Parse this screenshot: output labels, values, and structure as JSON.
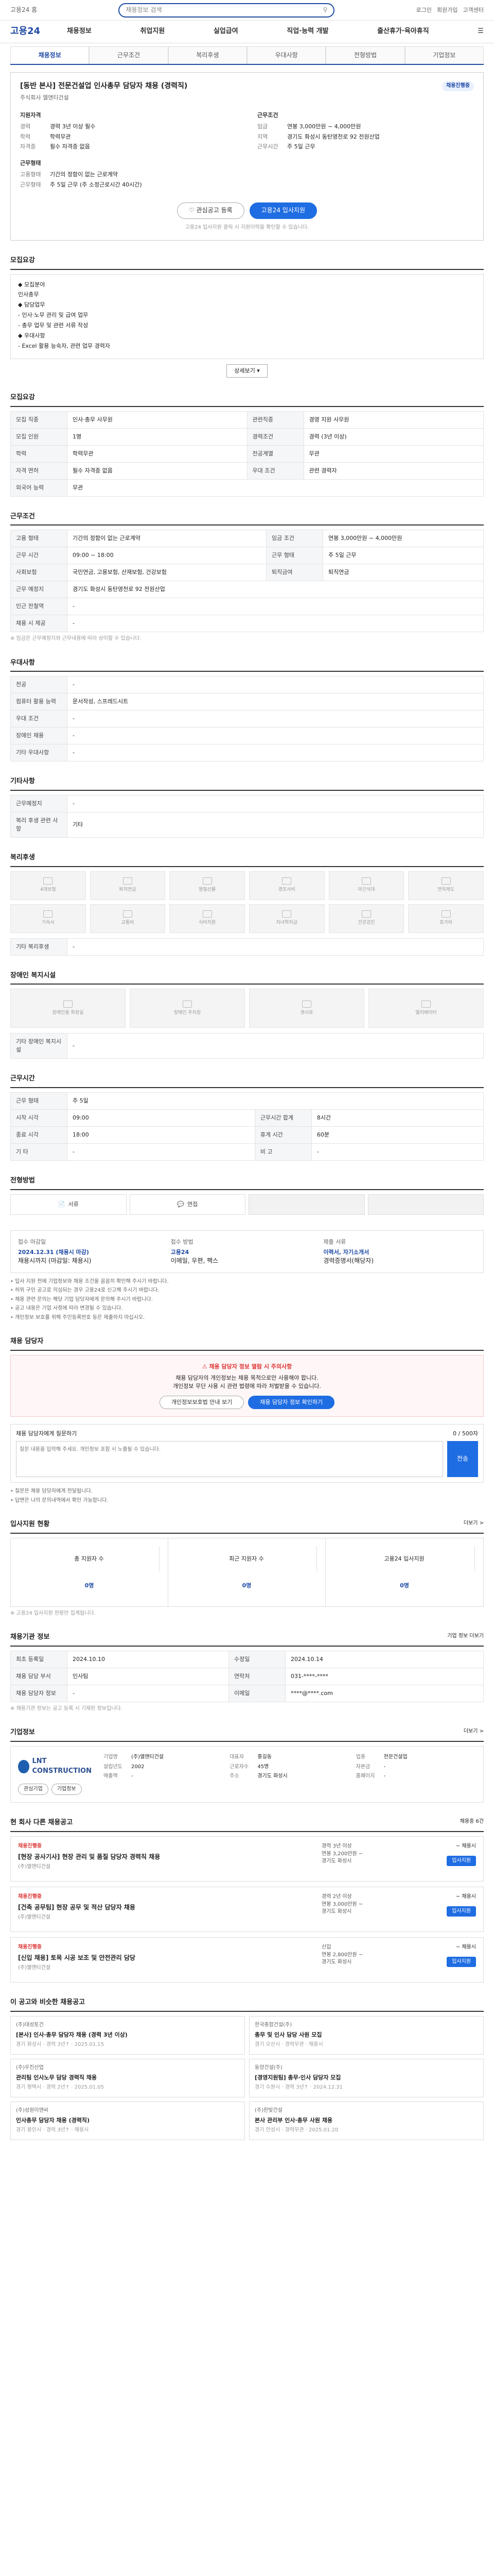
{
  "top": {
    "home": "고용24 홈",
    "brand": "고용24",
    "search_placeholder": "채용정보 검색",
    "links": [
      "로그인",
      "회원가입",
      "고객센터"
    ]
  },
  "gnb": {
    "logo": "고용24",
    "menu": [
      "채용정보",
      "취업지원",
      "실업급여",
      "직업·능력 개발",
      "출산휴가·육아휴직"
    ]
  },
  "tabs": [
    "채용정보",
    "근무조건",
    "복리후생",
    "우대사항",
    "전형방법",
    "기업정보"
  ],
  "job": {
    "title": "[동반 본사] 전문건설업 인사총무 담당자 채용 (경력직)",
    "badge": "채용진행중",
    "company": "주식회사 엘앤티건설",
    "req_head": "지원자격",
    "req": [
      [
        "경력",
        "경력 3년 이상 필수"
      ],
      [
        "학력",
        "학력무관"
      ],
      [
        "자격증",
        "필수 자격증 없음"
      ]
    ],
    "cond_head": "근무조건",
    "cond": [
      [
        "임금",
        "연봉 3,000만원 ~ 4,000만원"
      ],
      [
        "지역",
        "경기도 화성시 동탄영천로 92 전원산업"
      ],
      [
        "근무시간",
        "주 5일 근무"
      ]
    ],
    "form_head": "근무형태",
    "form": [
      [
        "고용형태",
        "기간의 정함이 없는 근로계약"
      ],
      [
        "근무형태",
        "주 5일 근무 (주 소정근로시간 40시간)"
      ]
    ]
  },
  "buttons": {
    "interest": "관심공고 등록",
    "apply": "고용24 입사지원"
  },
  "note": "고용24 입사지원 클릭 시 지원이력을 확인할 수 있습니다.",
  "s_duty": {
    "h": "모집요강",
    "lines": [
      "◆ 모집분야",
      "인사총무",
      "◆ 담당업무",
      "- 인사·노무 관리 및 급여 업무",
      "- 총무 업무 및 관련 서류 작성",
      "◆ 우대사항",
      "- Excel 활용 능숙자, 관련 업무 경력자"
    ],
    "more": "상세보기 ▾"
  },
  "s_recruit": {
    "h": "모집요강",
    "rows": [
      [
        "모집 직종",
        "인사·총무 사무원",
        "관련직종",
        "경영 지원 사무원"
      ],
      [
        "모집 인원",
        "1명",
        "경력조건",
        "경력 (3년 이상)"
      ],
      [
        "학력",
        "학력무관",
        "전공계열",
        "무관"
      ],
      [
        "자격 면허",
        "필수 자격증 없음",
        "우대 조건",
        "관련 경력자"
      ],
      [
        "외국어 능력",
        "무관",
        "",
        ""
      ]
    ]
  },
  "s_cond": {
    "h": "근무조건",
    "rows": [
      [
        "고용 형태",
        "기간의 정함이 없는 근로계약",
        "임금 조건",
        "연봉 3,000만원 ~ 4,000만원"
      ],
      [
        "근무 시간",
        "09:00 ~ 18:00",
        "근무 형태",
        "주 5일 근무"
      ],
      [
        "사회보험",
        "국민연금, 고용보험, 산재보험, 건강보험",
        "퇴직금여",
        "퇴직연금"
      ],
      [
        "근무 예정지",
        "경기도 화성시 동탄영천로 92 전원산업",
        "",
        ""
      ],
      [
        "인근 전철역",
        "-",
        "",
        ""
      ],
      [
        "채용 시 제공",
        "-",
        "",
        ""
      ]
    ],
    "note": "※ 임금은 근무예정지와 근무내용에 따라 상이할 수 있습니다."
  },
  "s_pref": {
    "h": "우대사항",
    "rows": [
      [
        "전공",
        "-"
      ],
      [
        "컴퓨터 활용 능력",
        "문서작성, 스프레드시트"
      ],
      [
        "우대 조건",
        "-"
      ],
      [
        "장애인 채용",
        "-"
      ],
      [
        "기타 우대사항",
        "-"
      ]
    ]
  },
  "s_etc": {
    "h": "기타사항",
    "rows": [
      [
        "근무예정지",
        "-"
      ],
      [
        "복리 후생 관련 사항",
        "기타"
      ]
    ]
  },
  "s_welfare": {
    "h": "복리후생",
    "icons": [
      "4대보험",
      "퇴직연금",
      "명절선물",
      "경조사비",
      "야근식대",
      "연차제도",
      "기숙사",
      "교통비",
      "식비지원",
      "자녀학자금",
      "건강검진",
      "휴가비"
    ],
    "etc_head": "기타 복리후생",
    "etc_val": "-"
  },
  "s_disab": {
    "h": "장애인 복지시설",
    "icons": [
      "장애인용 화장실",
      "장애인 주차장",
      "경사로",
      "엘리베이터"
    ],
    "etc_head": "기타 장애인 복지시설",
    "etc_val": "-"
  },
  "s_work": {
    "h": "근무시간",
    "rows": [
      [
        "근무 형태",
        "주 5일",
        "",
        ""
      ],
      [
        "시작 시각",
        "09:00",
        "근무시간 합계",
        "8시간"
      ],
      [
        "종료 시각",
        "18:00",
        "휴게 시간",
        "60분"
      ],
      [
        "기 타",
        "-",
        "비 고",
        "-"
      ]
    ]
  },
  "s_proc": {
    "h": "전형방법",
    "steps": [
      "서류",
      "면접",
      "",
      ""
    ]
  },
  "s_apply": {
    "h": "",
    "cols": [
      {
        "h": "접수 마감일",
        "v": "2024.12.31 (채용시 마감)",
        "b": "채용시까지 (마감일: 채용시)"
      },
      {
        "h": "접수 방법",
        "v": "고용24",
        "b": "이메일, 우편, 팩스"
      },
      {
        "h": "제출 서류",
        "v": "이력서, 자기소개서",
        "b": "경력증명서(해당자)"
      }
    ],
    "bullets": [
      "• 입사 지원 전에 기업정보와 채용 조건을 꼼꼼히 확인해 주시기 바랍니다.",
      "• 허위 구인 공고로 의심되는 경우 고용24로 신고해 주시기 바랍니다.",
      "• 채용 관련 문의는 해당 기업 담당자에게 문의해 주시기 바랍니다.",
      "• 공고 내용은 기업 사정에 따라 변경될 수 있습니다.",
      "• 개인정보 보호를 위해 주민등록번호 등은 제출하지 마십시오."
    ]
  },
  "s_contact": {
    "h": "채용 담당자",
    "warn": "채용 담당자 정보 열람 시 주의사항",
    "line1": "채용 담당자의 개인정보는 채용 목적으로만 사용해야 합니다.",
    "line2": "개인정보 무단 사용 시 관련 법령에 따라 처벌받을 수 있습니다.",
    "b1": "개인정보보호법 안내 보기",
    "b2": "채용 담당자 정보 확인하기",
    "chat_head": "채용 담당자에게 질문하기",
    "chat_count": "0 / 500자",
    "chat_ph": "질문 내용을 입력해 주세요. 개인정보 포함 시 노출될 수 있습니다.",
    "send": "전송",
    "notes": [
      "• 질문은 채용 담당자에게 전달됩니다.",
      "• 답변은 나의 문의내역에서 확인 가능합니다."
    ]
  },
  "s_review": {
    "h": "입사지원 현황",
    "more": "더보기 >",
    "cols": [
      [
        "총 지원자 수",
        "0명"
      ],
      [
        "최근 지원자 수",
        "0명"
      ],
      [
        "고용24 입사지원",
        "0명"
      ]
    ],
    "note": "※ 고용24 입사지원 현황만 집계됩니다."
  },
  "s_info": {
    "h": "채용기관 정보",
    "more": "기업 정보 더보기",
    "rows": [
      [
        "최초 등록일",
        "2024.10.10",
        "수정일",
        "2024.10.14"
      ],
      [
        "채용 담당 부서",
        "인사팀",
        "연락처",
        "031-****-****"
      ],
      [
        "채용 담당자 정보",
        "-",
        "이메일",
        "****@****.com"
      ]
    ],
    "note": "※ 채용기관 정보는 공고 등록 시 기재된 정보입니다."
  },
  "s_company": {
    "h": "기업정보",
    "more": "더보기 >",
    "name": "LNT CONSTRUCTION",
    "rows": [
      [
        "기업명",
        "(주)엘앤티건설"
      ],
      [
        "대표자",
        "홍길동"
      ],
      [
        "업종",
        "전문건설업"
      ],
      [
        "설립년도",
        "2002"
      ],
      [
        "근로자수",
        "45명"
      ],
      [
        "자본금",
        "-"
      ],
      [
        "매출액",
        "-"
      ],
      [
        "주소",
        "경기도 화성시"
      ],
      [
        "홈페이지",
        "-"
      ]
    ],
    "btn1": "관심기업",
    "btn2": "기업정보"
  },
  "s_others": {
    "h": "현 회사 다른 채용공고",
    "more": "채용중 6건",
    "jobs": [
      {
        "tag": "채용진행중",
        "t": "[현장 공사기사] 현장 관리 및 품질 담당자 경력직 채용",
        "s": "(주)엘앤티건설",
        "m": [
          "경력 3년 이상",
          "연봉 3,200만원 ~",
          "경기도 화성시"
        ],
        "d": "~ 채용시",
        "btn": "입사지원"
      },
      {
        "tag": "채용진행중",
        "t": "[건축 공무팀] 현장 공무 및 적산 담당자 채용",
        "s": "(주)엘앤티건설",
        "m": [
          "경력 2년 이상",
          "연봉 3,000만원 ~",
          "경기도 화성시"
        ],
        "d": "~ 채용시",
        "btn": "입사지원"
      },
      {
        "tag": "채용진행중",
        "t": "[신입 채용] 토목 시공 보조 및 안전관리 담당",
        "s": "(주)엘앤티건설",
        "m": [
          "신입",
          "연봉 2,800만원 ~",
          "경기도 화성시"
        ],
        "d": "~ 채용시",
        "btn": "입사지원"
      }
    ]
  },
  "s_rec": {
    "h": "이 공고와 비슷한 채용공고",
    "items": [
      {
        "c": "(주)대성토건",
        "t": "[본사] 인사·총무 담당자 채용 (경력 3년 이상)",
        "d": "경기 화성시 · 경력 3년↑ · 2025.01.15"
      },
      {
        "c": "한국종합건설(주)",
        "t": "총무 및 인사 담당 사원 모집",
        "d": "경기 오산시 · 경력무관 · 채용시"
      },
      {
        "c": "(주)우진산업",
        "t": "관리팀 인사노무 담당 경력직 채용",
        "d": "경기 평택시 · 경력 2년↑ · 2025.01.05"
      },
      {
        "c": "동양건설(주)",
        "t": "[경영지원팀] 총무·인사 담당자 모집",
        "d": "경기 수원시 · 경력 3년↑ · 2024.12.31"
      },
      {
        "c": "(주)성원이앤씨",
        "t": "인사총무 담당자 채용 (경력직)",
        "d": "경기 용인시 · 경력 3년↑ · 채용시"
      },
      {
        "c": "(주)한빛건설",
        "t": "본사 관리부 인사·총무 사원 채용",
        "d": "경기 안성시 · 경력무관 · 2025.01.20"
      }
    ]
  }
}
